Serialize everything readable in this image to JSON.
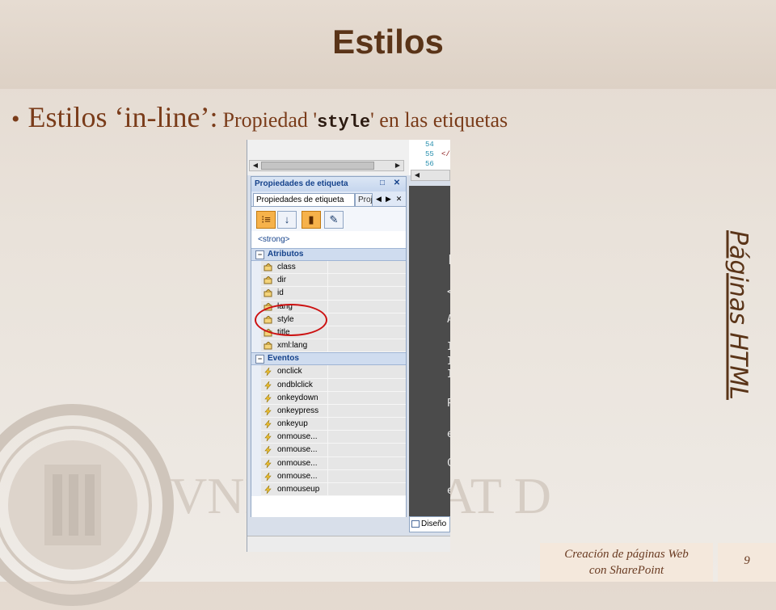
{
  "slide": {
    "title": "Estilos",
    "bullet": {
      "lead": "Estilos ‘in-line’:",
      "prefix": "Propiedad '",
      "code": "style",
      "suffix": "' en las etiquetas"
    },
    "side_label": "Páginas HTML",
    "footer_line1": "Creación de páginas Web",
    "footer_line2": "con SharePoint",
    "page_number": "9",
    "watermark_letters": "VNIVERSITAT DE VALÈNCIA"
  },
  "code_view": {
    "line_numbers": [
      "54",
      "55",
      "56"
    ],
    "line_code": [
      "",
      "</",
      ""
    ],
    "glyphs": [
      "[",
      "<",
      "A",
      "I",
      "I",
      "I",
      "P",
      "e",
      "C",
      "e",
      "A"
    ]
  },
  "panel": {
    "header_title": "Propiedades de etiqueta",
    "header_buttons": [
      "□",
      "✕"
    ],
    "tabs": [
      {
        "label": "Propiedades de etiqueta",
        "active": true
      },
      {
        "label": "Proj",
        "active": false
      }
    ],
    "tab_nav": [
      "◀",
      "▶",
      "✕"
    ],
    "toolbar": [
      {
        "icon": "categorized-icon",
        "glyph": "⁝≡",
        "active": true
      },
      {
        "icon": "sort-az-icon",
        "glyph": "↓",
        "active": false
      },
      {
        "icon": "show-set-properties-icon",
        "glyph": "▮",
        "active": true
      },
      {
        "icon": "tag-properties-icon",
        "glyph": "✎",
        "active": false
      }
    ],
    "current_tag": "<strong>",
    "groups": [
      {
        "name": "Atributos",
        "expanded": true,
        "items": [
          "class",
          "dir",
          "id",
          "lang",
          "style",
          "title",
          "xml:lang"
        ],
        "icon": "attribute-icon"
      },
      {
        "name": "Eventos",
        "expanded": true,
        "items": [
          "onclick",
          "ondblclick",
          "onkeydown",
          "onkeypress",
          "onkeyup",
          "onmouse...",
          "onmouse...",
          "onmouse...",
          "onmouse...",
          "onmouseup"
        ],
        "icon": "event-lightning-icon"
      }
    ]
  },
  "status": {
    "design_tab": "Diseño"
  },
  "colors": {
    "title": "#5a3418",
    "bullet": "#7a3c1a",
    "highlight": "#cc1111",
    "panel_header": "#15428b",
    "toolbar_active": "#f6b24a"
  }
}
